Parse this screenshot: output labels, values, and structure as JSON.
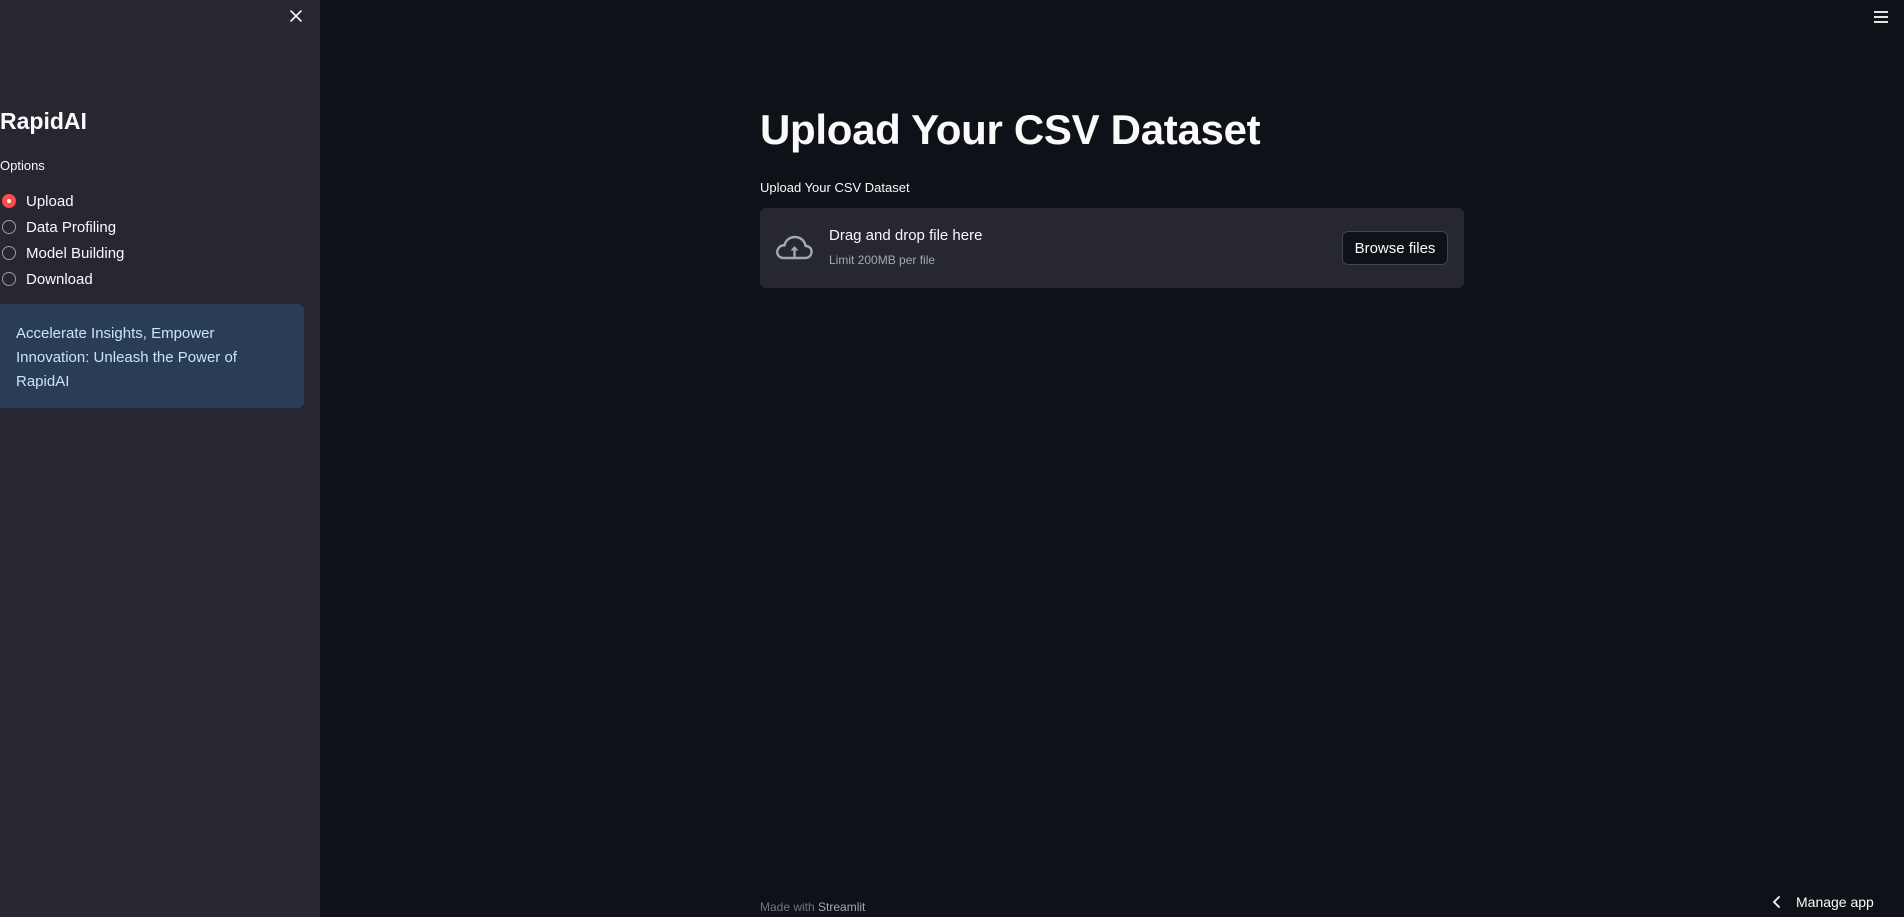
{
  "sidebar": {
    "title": "RapidAI",
    "options_label": "Options",
    "options": [
      {
        "label": "Upload",
        "selected": true
      },
      {
        "label": "Data Profiling",
        "selected": false
      },
      {
        "label": "Model Building",
        "selected": false
      },
      {
        "label": "Download",
        "selected": false
      }
    ],
    "info_text": "Accelerate Insights, Empower Innovation: Unleash the Power of RapidAI"
  },
  "main": {
    "title": "Upload Your CSV Dataset",
    "uploader": {
      "label": "Upload Your CSV Dataset",
      "drop_text": "Drag and drop file here",
      "limit_text": "Limit 200MB per file",
      "browse_label": "Browse files"
    }
  },
  "footer": {
    "made_with": "Made with",
    "brand": "Streamlit"
  },
  "manage_app": {
    "label": "Manage app"
  },
  "icons": {
    "close": "close-icon",
    "menu": "hamburger-menu-icon",
    "upload": "cloud-upload-icon",
    "manage": "chevron-left-icon"
  },
  "colors": {
    "background": "#0e1117",
    "sidebar": "#262730",
    "accent": "#ff4b4b",
    "info_bg": "#2a3d57",
    "info_text": "#c7e4fb"
  }
}
